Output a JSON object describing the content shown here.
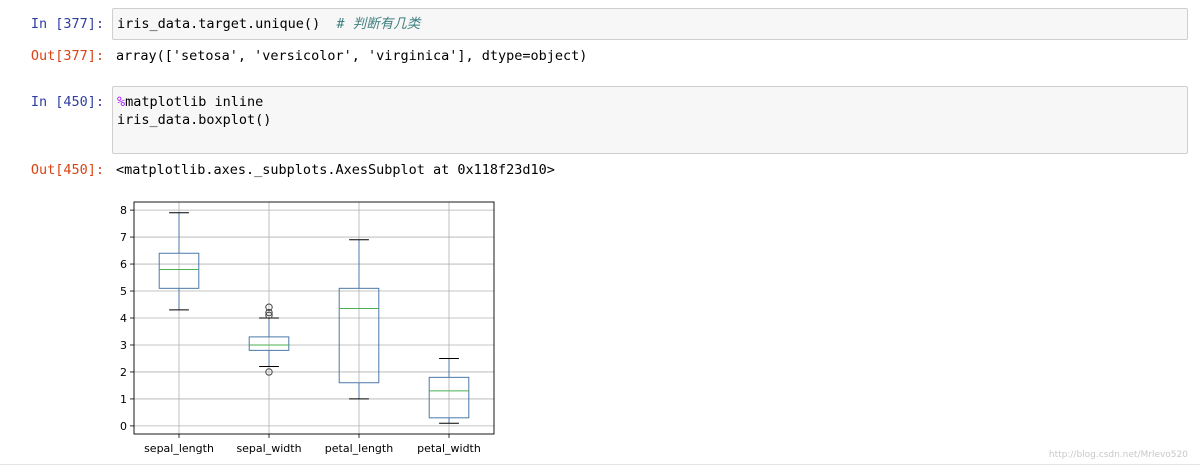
{
  "cells": {
    "c1": {
      "in_prompt": "In [377]:",
      "code_lines": [
        "iris_data.target.unique()"
      ],
      "comment": "# 判断有几类",
      "out_prompt": "Out[377]:",
      "output": "array(['setosa', 'versicolor', 'virginica'], dtype=object)"
    },
    "c2": {
      "in_prompt": "In [450]:",
      "magic": "%",
      "line1_rest": "matplotlib inline",
      "line2": "iris_data.boxplot()",
      "out_prompt": "Out[450]:",
      "output": "<matplotlib.axes._subplots.AxesSubplot at 0x118f23d10>"
    }
  },
  "chart_data": {
    "type": "boxplot",
    "categories": [
      "sepal_length",
      "sepal_width",
      "petal_length",
      "petal_width"
    ],
    "ylim": [
      -0.3,
      8.3
    ],
    "yticks": [
      "0",
      "1",
      "2",
      "3",
      "4",
      "5",
      "6",
      "7",
      "8"
    ],
    "grid": true,
    "box_color": "#4c78a8",
    "median_color": "#4caf50",
    "boxes": [
      {
        "name": "sepal_length",
        "whislo": 4.3,
        "q1": 5.1,
        "med": 5.8,
        "q3": 6.4,
        "whishi": 7.9,
        "fliers": []
      },
      {
        "name": "sepal_width",
        "whislo": 2.2,
        "q1": 2.8,
        "med": 3.0,
        "q3": 3.3,
        "whishi": 4.0,
        "fliers": [
          2.0,
          4.1,
          4.2,
          4.4
        ]
      },
      {
        "name": "petal_length",
        "whislo": 1.0,
        "q1": 1.6,
        "med": 4.35,
        "q3": 5.1,
        "whishi": 6.9,
        "fliers": []
      },
      {
        "name": "petal_width",
        "whislo": 0.1,
        "q1": 0.3,
        "med": 1.3,
        "q3": 1.8,
        "whishi": 2.5,
        "fliers": []
      }
    ]
  },
  "watermark": "http://blog.csdn.net/Mrlevo520"
}
